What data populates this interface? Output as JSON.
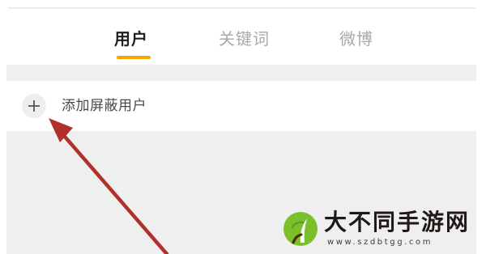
{
  "tabs": [
    {
      "label": "用户",
      "active": true
    },
    {
      "label": "关键词",
      "active": false
    },
    {
      "label": "微博",
      "active": false
    }
  ],
  "add_row": {
    "icon": "plus-icon",
    "label": "添加屏蔽用户"
  },
  "annotation": {
    "type": "arrow",
    "color": "#b0312a",
    "points_to": "add-blocked-user-button"
  },
  "watermark": {
    "brand": "大不同手游网",
    "url": "www.szdbtgg.com"
  },
  "colors": {
    "accent": "#f7a400",
    "tab_active": "#1e1e1e",
    "tab_inactive": "#a9a9a9",
    "background_band": "#efefef"
  }
}
